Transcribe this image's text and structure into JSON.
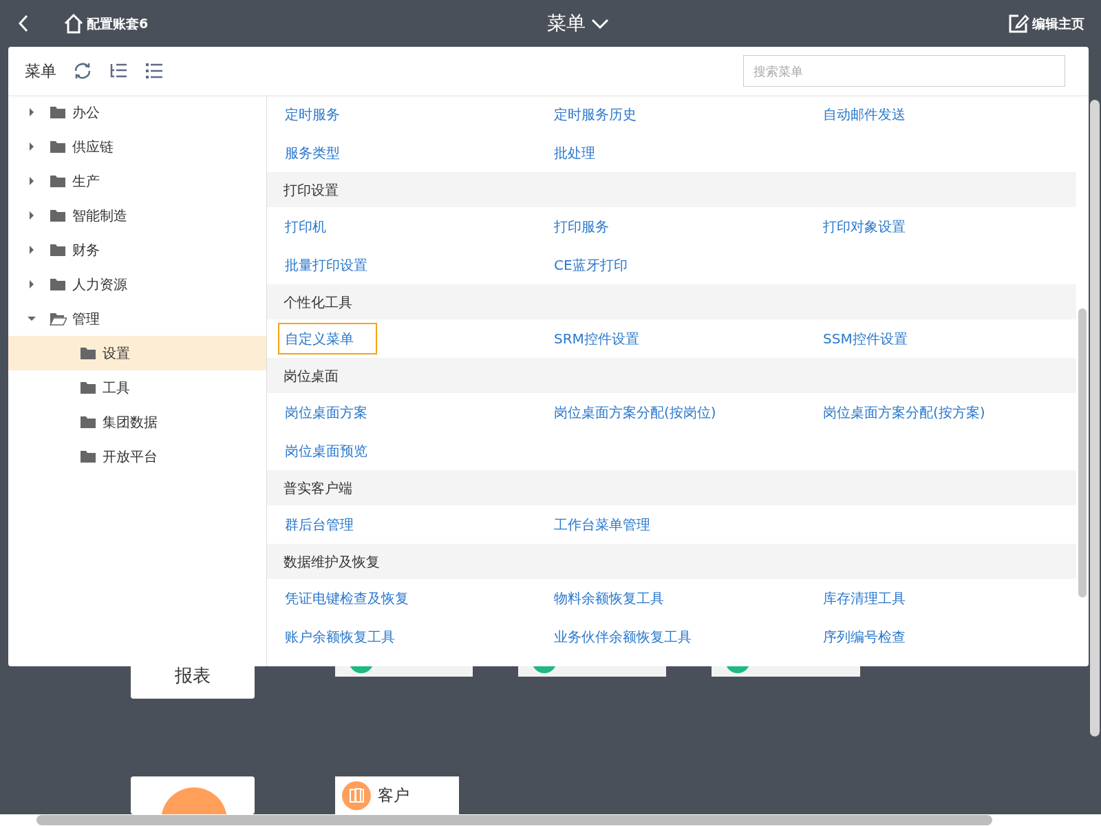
{
  "topbar": {
    "home_label": "配置账套6",
    "title": "菜单",
    "edit_label": "编辑主页"
  },
  "menu_panel": {
    "title": "菜单",
    "search": {
      "placeholder": "搜索菜单"
    },
    "tree": [
      {
        "label": "办公",
        "expanded": false,
        "selected": false
      },
      {
        "label": "供应链",
        "expanded": false,
        "selected": false
      },
      {
        "label": "生产",
        "expanded": false,
        "selected": false
      },
      {
        "label": "智能制造",
        "expanded": false,
        "selected": false
      },
      {
        "label": "财务",
        "expanded": false,
        "selected": false
      },
      {
        "label": "人力资源",
        "expanded": false,
        "selected": false
      },
      {
        "label": "管理",
        "expanded": true,
        "selected": false,
        "children": [
          {
            "label": "设置",
            "selected": true
          },
          {
            "label": "工具",
            "selected": false
          },
          {
            "label": "集团数据",
            "selected": false
          },
          {
            "label": "开放平台",
            "selected": false
          }
        ]
      }
    ],
    "sections": [
      {
        "links": [
          {
            "label": "定时服务",
            "highlighted": false
          },
          {
            "label": "定时服务历史",
            "highlighted": false
          },
          {
            "label": "自动邮件发送",
            "highlighted": false
          },
          {
            "label": "服务类型",
            "highlighted": false
          },
          {
            "label": "批处理",
            "highlighted": false
          }
        ]
      },
      {
        "title": "打印设置",
        "links": [
          {
            "label": "打印机",
            "highlighted": false
          },
          {
            "label": "打印服务",
            "highlighted": false
          },
          {
            "label": "打印对象设置",
            "highlighted": false
          },
          {
            "label": "批量打印设置",
            "highlighted": false
          },
          {
            "label": "CE蓝牙打印",
            "highlighted": false
          }
        ]
      },
      {
        "title": "个性化工具",
        "links": [
          {
            "label": "自定义菜单",
            "highlighted": true
          },
          {
            "label": "SRM控件设置",
            "highlighted": false
          },
          {
            "label": "SSM控件设置",
            "highlighted": false
          }
        ]
      },
      {
        "title": "岗位桌面",
        "links": [
          {
            "label": "岗位桌面方案",
            "highlighted": false
          },
          {
            "label": "岗位桌面方案分配(按岗位)",
            "highlighted": false
          },
          {
            "label": "岗位桌面方案分配(按方案)",
            "highlighted": false
          },
          {
            "label": "岗位桌面预览",
            "highlighted": false
          }
        ]
      },
      {
        "title": "普实客户端",
        "links": [
          {
            "label": "群后台管理",
            "highlighted": false
          },
          {
            "label": "工作台菜单管理",
            "highlighted": false
          }
        ]
      },
      {
        "title": "数据维护及恢复",
        "links": [
          {
            "label": "凭证电键检查及恢复",
            "highlighted": false
          },
          {
            "label": "物料余额恢复工具",
            "highlighted": false
          },
          {
            "label": "库存清理工具",
            "highlighted": false
          },
          {
            "label": "账户余额恢复工具",
            "highlighted": false
          },
          {
            "label": "业务伙伴余额恢复工具",
            "highlighted": false
          },
          {
            "label": "序列编号检查",
            "highlighted": false
          }
        ]
      }
    ]
  },
  "background_tiles": [
    {
      "kind": "text",
      "label": "报表"
    },
    {
      "kind": "covered"
    },
    {
      "kind": "covered"
    },
    {
      "kind": "covered"
    },
    {
      "kind": "big-icon"
    },
    {
      "kind": "labeled",
      "label": "客户"
    }
  ]
}
